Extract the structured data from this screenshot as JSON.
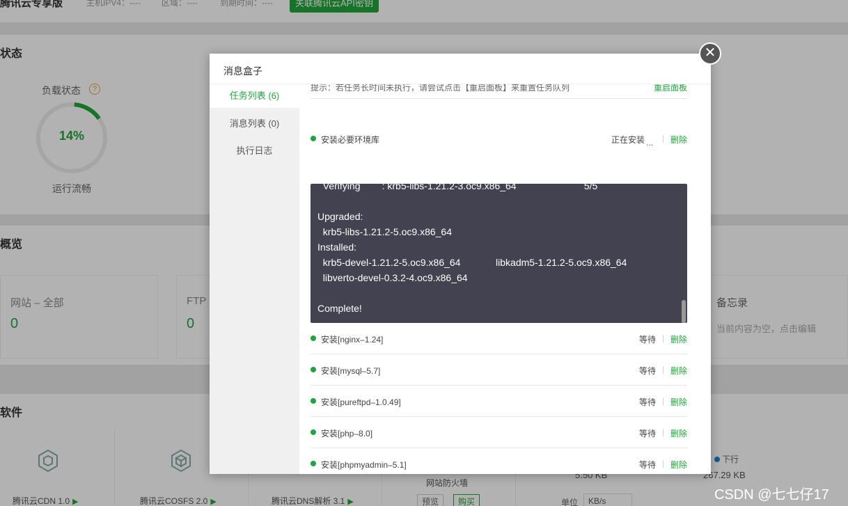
{
  "topbar": {
    "brand": "腾讯云专享版",
    "ipv4": "主机IPV4：----",
    "region": "区域：----",
    "expiry": "到期时间：----",
    "api_button": "关联腾讯云API密钥"
  },
  "status_section": {
    "title": "状态",
    "load_label": "负载状态",
    "help_icon": "question-icon",
    "load_percent": "14%",
    "load_value": 0.14,
    "load_status": "运行流畅"
  },
  "overview_section": {
    "title": "概览",
    "cards": [
      {
        "label": "网站 – 全部",
        "value": "0"
      },
      {
        "label": "FTP",
        "value": "0"
      },
      {
        "label": "备忘录",
        "value": "当前内容为空，点击编辑"
      }
    ]
  },
  "software_section": {
    "title": "软件",
    "items": [
      {
        "name": "腾讯云CDN 1.0"
      },
      {
        "name": "腾讯云COSFS 2.0"
      },
      {
        "name": "腾讯云DNS解析 3.1"
      },
      {
        "name": "网站防火墙",
        "preview": "预览",
        "buy": "购买"
      }
    ],
    "traffic": {
      "download_label": "下行",
      "upload_value": "5.50 KB",
      "download_value": "267.29 KB",
      "unit_label": "单位",
      "unit_value": "KB/s"
    }
  },
  "modal": {
    "title": "消息盒子",
    "close_icon": "close-icon",
    "tabs": [
      {
        "label": "任务列表 (6)",
        "active": true
      },
      {
        "label": "消息列表 (0)",
        "active": false
      },
      {
        "label": "执行日志",
        "active": false
      }
    ],
    "tip": "提示：若任务长时间未执行，请尝试点击【重启面板】来重置任务队列",
    "relaunch_link": "重启面板",
    "tasks": [
      {
        "name": "安装必要环境库",
        "status": "正在安装",
        "delete": "删除"
      },
      {
        "name": "安装[nginx–1.24]",
        "status": "等待",
        "delete": "删除"
      },
      {
        "name": "安装[mysql–5.7]",
        "status": "等待",
        "delete": "删除"
      },
      {
        "name": "安装[pureftpd–1.0.49]",
        "status": "等待",
        "delete": "删除"
      },
      {
        "name": "安装[php–8.0]",
        "status": "等待",
        "delete": "删除"
      },
      {
        "name": "安装[phpmyadmin–5.1]",
        "status": "等待",
        "delete": "删除"
      }
    ],
    "running_dots": "...",
    "console_lines": [
      "  Verifying        : krb5-libs-1.21.2-3.oc9.x86_64                         5/5",
      "Upgraded:",
      "  krb5-libs-1.21.2-5.oc9.x86_64",
      "Installed:",
      "  krb5-devel-1.21.2-5.oc9.x86_64             libkadm5-1.21.2-5.oc9.x86_64",
      "  libverto-devel-0.3.2-4.oc9.x86_64",
      "Complete!"
    ]
  },
  "watermark": "CSDN @七七仔17"
}
